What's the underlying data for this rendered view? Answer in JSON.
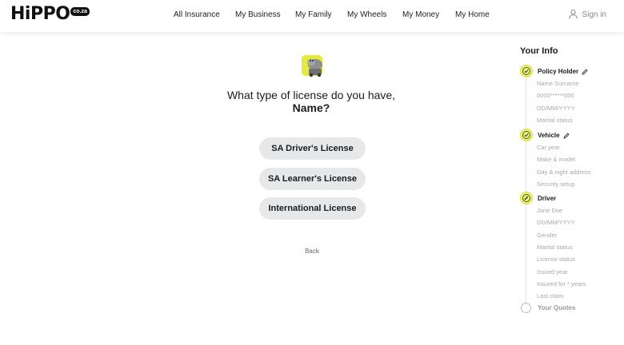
{
  "header": {
    "logo_word": "HiPPO",
    "logo_tld": "co.za",
    "nav": [
      "All Insurance",
      "My Business",
      "My Family",
      "My Wheels",
      "My Money",
      "My Home"
    ],
    "sign_in": "Sign in"
  },
  "main": {
    "question_line1": "What type of license do you have,",
    "question_name": "Name?",
    "options": [
      "SA Driver's License",
      "SA Learner's License",
      "International License"
    ],
    "back": "Back"
  },
  "sidebar": {
    "title": "Your Info",
    "steps": [
      {
        "title": "Policy Holder",
        "items": [
          "Name Surname",
          "0000******000",
          "DD/MM/YYYY",
          "Marital status"
        ]
      },
      {
        "title": "Vehicle",
        "items": [
          "Car year",
          "Make & model",
          "Day & night address",
          "Security setup"
        ]
      },
      {
        "title": "Driver",
        "items": [
          "Jane Doe",
          "DD/MM/YYYY",
          "Gender",
          "Marital status",
          "License status",
          "Issued year",
          "Insured for * years",
          "Last claim"
        ]
      },
      {
        "title": "Your Quotes",
        "items": []
      }
    ]
  },
  "colors": {
    "accent": "#e8f36a",
    "button_bg": "#e7e8ea"
  }
}
